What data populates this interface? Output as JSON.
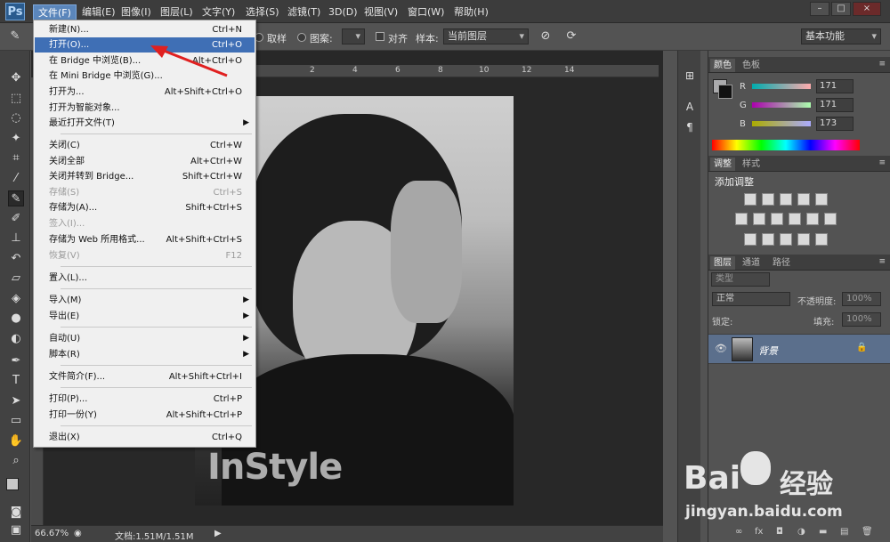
{
  "app": {
    "logo": "Ps"
  },
  "menubar": {
    "items": [
      "文件(F)",
      "编辑(E)",
      "图像(I)",
      "图层(L)",
      "文字(Y)",
      "选择(S)",
      "滤镜(T)",
      "3D(D)",
      "视图(V)",
      "窗口(W)",
      "帮助(H)"
    ],
    "active_index": 0,
    "window_buttons": [
      "–",
      "□",
      "×"
    ]
  },
  "options": {
    "sample_label": "取样",
    "pattern_label": "图案:",
    "align_label": "对齐",
    "sample2_label": "样本:",
    "sample_value": "当前图层",
    "workspace": "基本功能"
  },
  "file_menu": {
    "items": [
      {
        "label": "新建(N)...",
        "shortcut": "Ctrl+N"
      },
      {
        "label": "打开(O)...",
        "shortcut": "Ctrl+O",
        "highlighted": true
      },
      {
        "label": "在 Bridge 中浏览(B)...",
        "shortcut": "Alt+Ctrl+O"
      },
      {
        "label": "在 Mini Bridge 中浏览(G)...",
        "shortcut": ""
      },
      {
        "label": "打开为...",
        "shortcut": "Alt+Shift+Ctrl+O"
      },
      {
        "label": "打开为智能对象...",
        "shortcut": ""
      },
      {
        "label": "最近打开文件(T)",
        "shortcut": "",
        "submenu": true
      },
      {
        "label": "关闭(C)",
        "shortcut": "Ctrl+W"
      },
      {
        "label": "关闭全部",
        "shortcut": "Alt+Ctrl+W"
      },
      {
        "label": "关闭并转到 Bridge...",
        "shortcut": "Shift+Ctrl+W"
      },
      {
        "label": "存储(S)",
        "shortcut": "Ctrl+S",
        "disabled": true
      },
      {
        "label": "存储为(A)...",
        "shortcut": "Shift+Ctrl+S"
      },
      {
        "label": "签入(I)...",
        "shortcut": "",
        "disabled": true
      },
      {
        "label": "存储为 Web 所用格式...",
        "shortcut": "Alt+Shift+Ctrl+S"
      },
      {
        "label": "恢复(V)",
        "shortcut": "F12",
        "disabled": true
      },
      {
        "label": "置入(L)...",
        "shortcut": ""
      },
      {
        "label": "导入(M)",
        "shortcut": "",
        "submenu": true
      },
      {
        "label": "导出(E)",
        "shortcut": "",
        "submenu": true
      },
      {
        "label": "自动(U)",
        "shortcut": "",
        "submenu": true
      },
      {
        "label": "脚本(R)",
        "shortcut": "",
        "submenu": true
      },
      {
        "label": "文件简介(F)...",
        "shortcut": "Alt+Shift+Ctrl+I"
      },
      {
        "label": "打印(P)...",
        "shortcut": "Ctrl+P"
      },
      {
        "label": "打印一份(Y)",
        "shortcut": "Alt+Shift+Ctrl+P"
      },
      {
        "label": "退出(X)",
        "shortcut": "Ctrl+Q"
      }
    ]
  },
  "canvas": {
    "ruler_marks": [
      "2",
      "4",
      "6",
      "8",
      "10",
      "12",
      "14"
    ],
    "photo_text": "InStyle"
  },
  "status": {
    "zoom": "66.67%",
    "doc": "文档:1.51M/1.51M"
  },
  "color_panel": {
    "tabs": [
      "颜色",
      "色板"
    ],
    "r_label": "R",
    "g_label": "G",
    "b_label": "B",
    "r": "171",
    "g": "171",
    "b": "173"
  },
  "adjust_panel": {
    "tabs": [
      "调整",
      "样式"
    ],
    "title": "添加调整"
  },
  "layers_panel": {
    "tabs": [
      "图层",
      "通道",
      "路径"
    ],
    "filter": "类型",
    "blend": "正常",
    "opacity_label": "不透明度:",
    "opacity": "100%",
    "lock_label": "锁定:",
    "fill_label": "填充:",
    "fill": "100%",
    "layer_name": "背景"
  },
  "watermark": {
    "brand": "Bai",
    "brand2": "经验",
    "url": "jingyan.baidu.com"
  }
}
